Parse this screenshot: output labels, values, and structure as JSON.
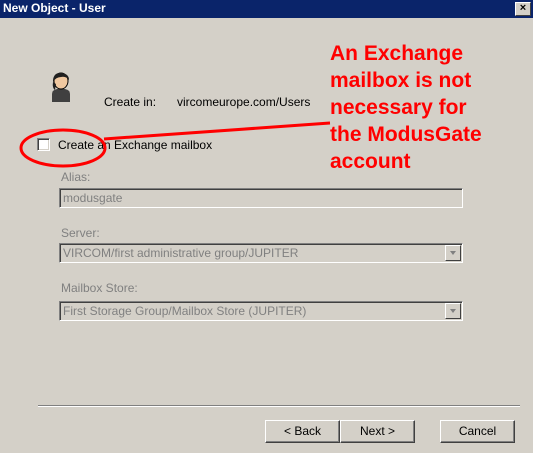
{
  "window": {
    "title": "New Object - User",
    "close_glyph": "×"
  },
  "header": {
    "create_in_label": "Create in:",
    "create_in_value": "vircomeurope.com/Users"
  },
  "exchange": {
    "checkbox_label": "Create an Exchange mailbox",
    "checked": false
  },
  "alias": {
    "label": "Alias:",
    "value": "modusgate"
  },
  "server": {
    "label": "Server:",
    "value": "VIRCOM/first administrative group/JUPITER"
  },
  "store": {
    "label": "Mailbox Store:",
    "value": "First Storage Group/Mailbox Store (JUPITER)"
  },
  "buttons": {
    "back": "< Back",
    "next": "Next >",
    "cancel": "Cancel"
  },
  "annotation": {
    "text": "An Exchange\nmailbox is not\nnecessary for\nthe ModusGate\naccount",
    "color": "#ff0000"
  },
  "icons": {
    "user": "user-icon",
    "close": "close-icon",
    "dropdown": "chevron-down-icon"
  }
}
